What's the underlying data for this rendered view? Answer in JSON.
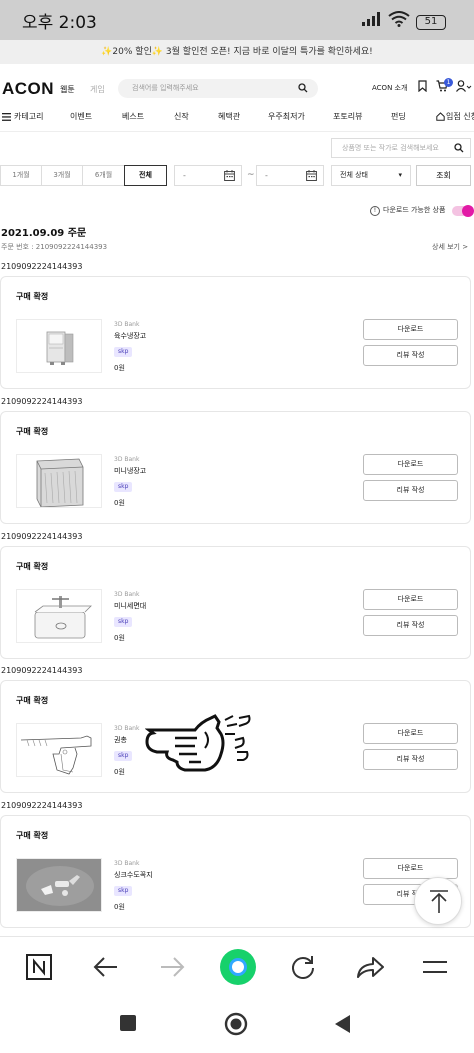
{
  "status_bar": {
    "time": "오후 2:03",
    "battery": "51"
  },
  "promo": {
    "text": "✨20% 할인✨ 3월 할인전 오픈! 지금 바로 이달의 특가를 확인하세요!"
  },
  "header": {
    "logo": "ACON",
    "tabs": [
      "웹툰",
      "게임"
    ],
    "search_placeholder": "검색어를 입력해주세요",
    "acon_intro": "ACON 소개",
    "cart_count": "1"
  },
  "nav": {
    "items": [
      "카테고리",
      "이벤트",
      "베스트",
      "신작",
      "혜택관",
      "우주최저가",
      "포토리뷰",
      "펀딩",
      "입점 신청"
    ]
  },
  "filters": {
    "search_placeholder": "상품명 또는 작가로 검색해보세요",
    "periods": [
      "1개월",
      "3개월",
      "6개월",
      "전체"
    ],
    "date_start": "-",
    "date_end": "-",
    "tilde": "~",
    "status_select": "전체 상태",
    "search_button": "조회",
    "downloadable_only": "다운로드 가능한 상품",
    "toggle_on": true
  },
  "order": {
    "date_title": "2021.09.09 주문",
    "order_number": "주문 번호 : 2109092224144393",
    "detail_link": "상세 보기 >"
  },
  "products": [
    {
      "order_id": "2109092224144393",
      "status": "구매 확정",
      "brand": "3D Bank",
      "name": "육수냉장고",
      "tag": "skp",
      "price": "0원",
      "download": "다운로드",
      "review": "리뷰 작성",
      "thumb": "fridge-tall"
    },
    {
      "order_id": "2109092224144393",
      "status": "구매 확정",
      "brand": "3D Bank",
      "name": "미니냉장고",
      "tag": "skp",
      "price": "0원",
      "download": "다운로드",
      "review": "리뷰 작성",
      "thumb": "fridge-mini"
    },
    {
      "order_id": "2109092224144393",
      "status": "구매 확정",
      "brand": "3D Bank",
      "name": "미니세면대",
      "tag": "skp",
      "price": "0원",
      "download": "다운로드",
      "review": "리뷰 작성",
      "thumb": "sink"
    },
    {
      "order_id": "2109092224144393",
      "status": "구매 확정",
      "brand": "3D Bank",
      "name": "권총",
      "tag": "skp",
      "price": "0원",
      "download": "다운로드",
      "review": "리뷰 작성",
      "thumb": "pistol"
    },
    {
      "order_id": "2109092224144393",
      "status": "구매 확정",
      "brand": "3D Bank",
      "name": "싱크수도꼭지",
      "tag": "skp",
      "price": "0원",
      "download": "다운로드",
      "review": "리뷰 작성",
      "thumb": "faucet"
    }
  ]
}
